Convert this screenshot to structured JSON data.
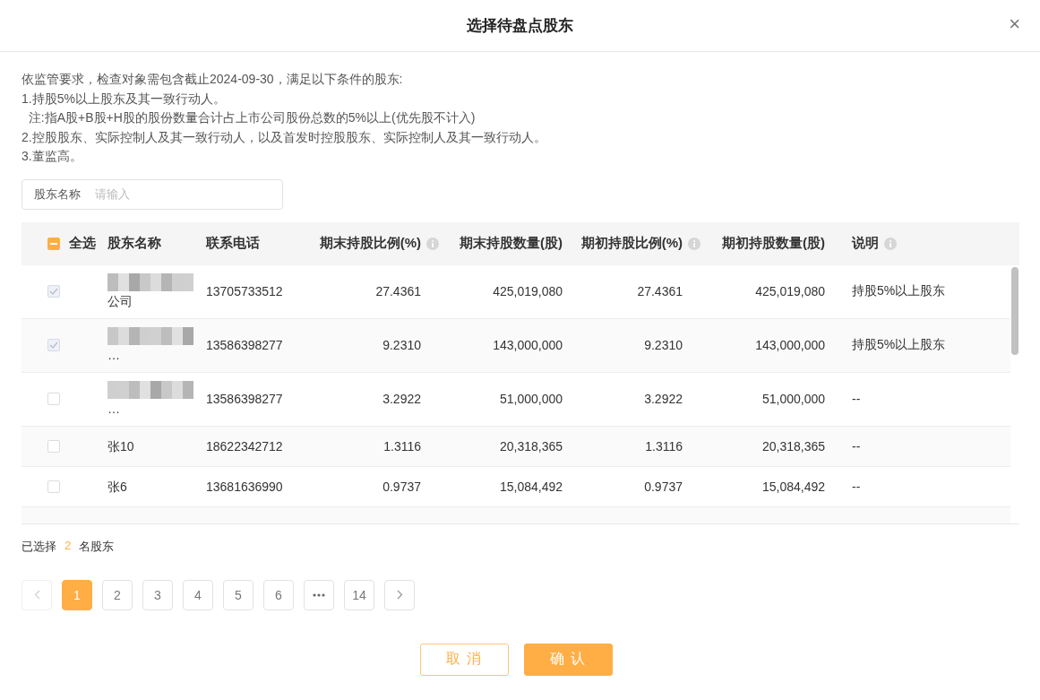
{
  "dialog": {
    "title": "选择待盘点股东",
    "close": "×"
  },
  "notice": [
    "依监管要求，检查对象需包含截止2024-09-30，满足以下条件的股东:",
    "1.持股5%以上股东及其一致行动人。",
    "  注:指A股+B股+H股的股份数量合计占上市公司股份总数的5%以上(优先股不计入)",
    "2.控股股东、实际控制人及其一致行动人，以及首发时控股股东、实际控制人及其一致行动人。",
    "3.董监高。"
  ],
  "search": {
    "label": "股东名称",
    "placeholder": "请输入"
  },
  "table": {
    "select_all": {
      "label": "全选",
      "indeterminate": true
    },
    "columns": [
      {
        "label": "股东名称",
        "info": false
      },
      {
        "label": "联系电话",
        "info": false
      },
      {
        "label": "期末持股比例(%)",
        "info": true
      },
      {
        "label": "期末持股数量(股)",
        "info": false
      },
      {
        "label": "期初持股比例(%)",
        "info": true
      },
      {
        "label": "期初持股数量(股)",
        "info": false
      },
      {
        "label": "说明",
        "info": true
      }
    ],
    "rows": [
      {
        "checked": true,
        "redacted": true,
        "cells": [
          "公司",
          "13705733512",
          "27.4361",
          "425,019,080",
          "27.4361",
          "425,019,080",
          "持股5%以上股东"
        ]
      },
      {
        "checked": true,
        "redacted": true,
        "cells": [
          "…",
          "13586398277",
          "9.2310",
          "143,000,000",
          "9.2310",
          "143,000,000",
          "持股5%以上股东"
        ]
      },
      {
        "checked": false,
        "redacted": true,
        "cells": [
          "…",
          "13586398277",
          "3.2922",
          "51,000,000",
          "3.2922",
          "51,000,000",
          "--"
        ]
      },
      {
        "checked": false,
        "redacted": false,
        "cells": [
          "张10",
          "18622342712",
          "1.3116",
          "20,318,365",
          "1.3116",
          "20,318,365",
          "--"
        ]
      },
      {
        "checked": false,
        "redacted": false,
        "cells": [
          "张6",
          "13681636990",
          "0.9737",
          "15,084,492",
          "0.9737",
          "15,084,492",
          "--"
        ]
      }
    ]
  },
  "selection": {
    "prefix": "已选择",
    "count": "2",
    "suffix": "名股东"
  },
  "pagination": {
    "pages": [
      {
        "label": "1",
        "selected": true
      },
      {
        "label": "2",
        "selected": false
      },
      {
        "label": "3",
        "selected": false
      },
      {
        "label": "4",
        "selected": false
      },
      {
        "label": "5",
        "selected": false
      },
      {
        "label": "6",
        "selected": false
      },
      {
        "label": "14",
        "selected": false
      }
    ]
  },
  "buttons": [
    {
      "label": "取 消",
      "kind": "secondary"
    },
    {
      "label": "确 认",
      "kind": "primary"
    }
  ]
}
